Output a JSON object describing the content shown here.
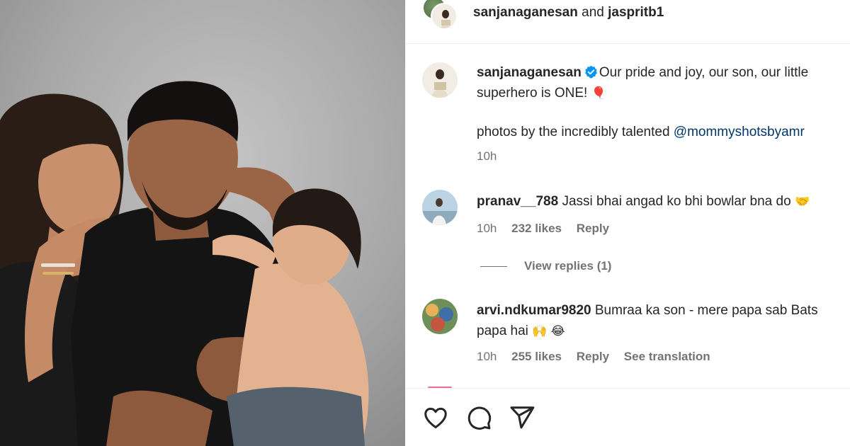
{
  "post": {
    "header": {
      "user1": "sanjanaganesan",
      "joiner": "and",
      "user2": "jaspritb1"
    },
    "caption": {
      "username": "sanjanaganesan",
      "line1": "Our pride and joy, our son, our little",
      "line2": "superhero is ONE!",
      "line2_emoji": "🎈",
      "credit_prefix": "photos by the incredibly talented",
      "credit_mention": "@mommyshotsbyamr",
      "time": "10h"
    },
    "comments": [
      {
        "username": "pranav__788",
        "text": "Jassi bhai angad ko bhi bowlar bna do",
        "emoji": "🤝",
        "time": "10h",
        "likes": "232 likes",
        "reply": "Reply",
        "view_replies": "View replies (1)"
      },
      {
        "username": "arvi.ndkumar9820",
        "text_line1": "Bumraa ka son - mere papa sab Bats",
        "text_line2": "papa hai",
        "emoji": "🙌 😂",
        "time": "10h",
        "likes": "255 likes",
        "reply": "Reply",
        "translate": "See translation"
      }
    ]
  },
  "actions": [
    "heart-icon",
    "comment-icon",
    "share-icon"
  ],
  "colors": {
    "mention": "#00376b",
    "verified": "#0095f6",
    "meta": "#737373"
  }
}
